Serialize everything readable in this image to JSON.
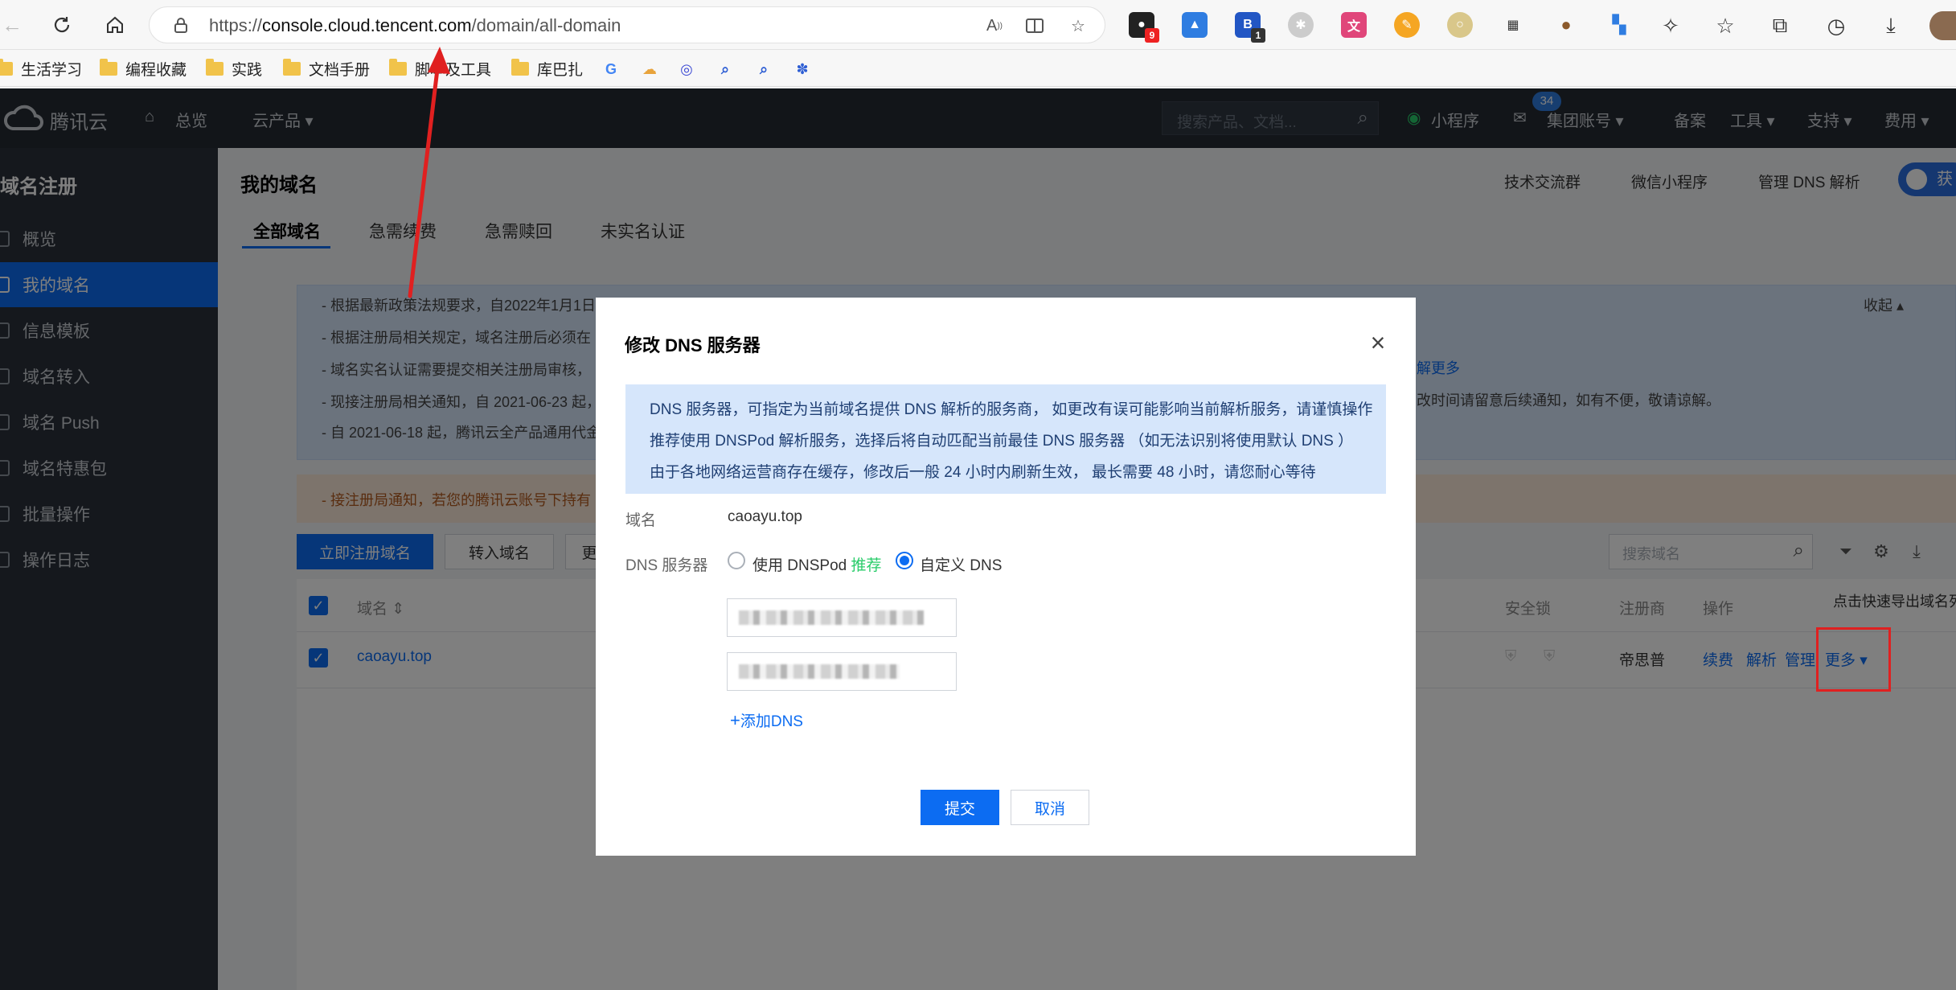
{
  "browser": {
    "url_prefix": "https://",
    "url_host": "console.cloud.tencent.com",
    "url_path": "/domain/all-domain",
    "ext_badge_1": "9",
    "ext_badge_2": "1"
  },
  "bookmarks": [
    {
      "label": "生活学习"
    },
    {
      "label": "编程收藏"
    },
    {
      "label": "实践"
    },
    {
      "label": "文档手册"
    },
    {
      "label": "脚本及工具"
    },
    {
      "label": "库巴扎"
    }
  ],
  "console_header": {
    "logo_text": "腾讯云",
    "home": "总览",
    "products": "云产品",
    "search_placeholder": "搜索产品、文档...",
    "mini_program": "小程序",
    "msg_count": "34",
    "group_account": "集团账号",
    "filing": "备案",
    "tools": "工具",
    "support": "支持",
    "billing": "费用"
  },
  "sidebar": {
    "title": "域名注册",
    "items": [
      {
        "label": "概览"
      },
      {
        "label": "我的域名"
      },
      {
        "label": "信息模板"
      },
      {
        "label": "域名转入"
      },
      {
        "label": "域名 Push"
      },
      {
        "label": "域名特惠包"
      },
      {
        "label": "批量操作"
      },
      {
        "label": "操作日志"
      }
    ]
  },
  "main": {
    "title": "我的域名",
    "links": [
      "技术交流群",
      "微信小程序",
      "管理 DNS 解析"
    ],
    "get_btn": "获",
    "tabs": [
      "全部域名",
      "急需续费",
      "急需赎回",
      "未实名认证"
    ],
    "collapse": "收起",
    "notices": [
      "- 根据最新政策法规要求，自2022年1月1日",
      "- 根据注册局相关规定，域名注册后必须在",
      "- 域名实名认证需要提交相关注册局审核，",
      "- 现接注册局相关通知，自 2021-06-23 起，",
      "- 自 2021-06-18 起，腾讯云全产品通用代金"
    ],
    "notice_right_1": "解更多",
    "notice_right_2": "改时间请留意后续通知，如有不便，敬请谅解。",
    "warning": "- 接注册局通知，若您的腾讯云账号下持有",
    "btn_register": "立即注册域名",
    "btn_transfer": "转入域名",
    "btn_more": "更",
    "search_placeholder": "搜索域名",
    "export_tip": "点击快速导出域名列",
    "columns": {
      "domain": "域名",
      "security_lock": "安全锁",
      "registrar": "注册商",
      "action": "操作"
    },
    "row": {
      "domain": "caoayu.top",
      "registrar": "帝思普",
      "renew": "续费",
      "resolve": "解析",
      "manage": "管理",
      "more": "更多"
    }
  },
  "modal": {
    "title": "修改 DNS 服务器",
    "info": [
      "DNS 服务器，可指定为当前域名提供 DNS 解析的服务商， 如更改有误可能影响当前解析服务，请谨慎操作",
      "推荐使用 DNSPod 解析服务，选择后将自动匹配当前最佳 DNS 服务器 （如无法识别将使用默认 DNS ）",
      "由于各地网络运营商存在缓存，修改后一般 24 小时内刷新生效， 最长需要 48 小时，请您耐心等待"
    ],
    "domain_label": "域名",
    "domain_value": "caoayu.top",
    "dns_label": "DNS 服务器",
    "option_dnspod": "使用 DNSPod",
    "recommend": "推荐",
    "option_custom": "自定义 DNS",
    "add_dns": "添加DNS",
    "submit": "提交",
    "cancel": "取消"
  },
  "colors": {
    "primary": "#0c6cf2",
    "header_bg": "#252b33",
    "sidebar_bg": "#2b313a",
    "recommend_green": "#29cc6a",
    "annotation_red": "#e02020"
  }
}
